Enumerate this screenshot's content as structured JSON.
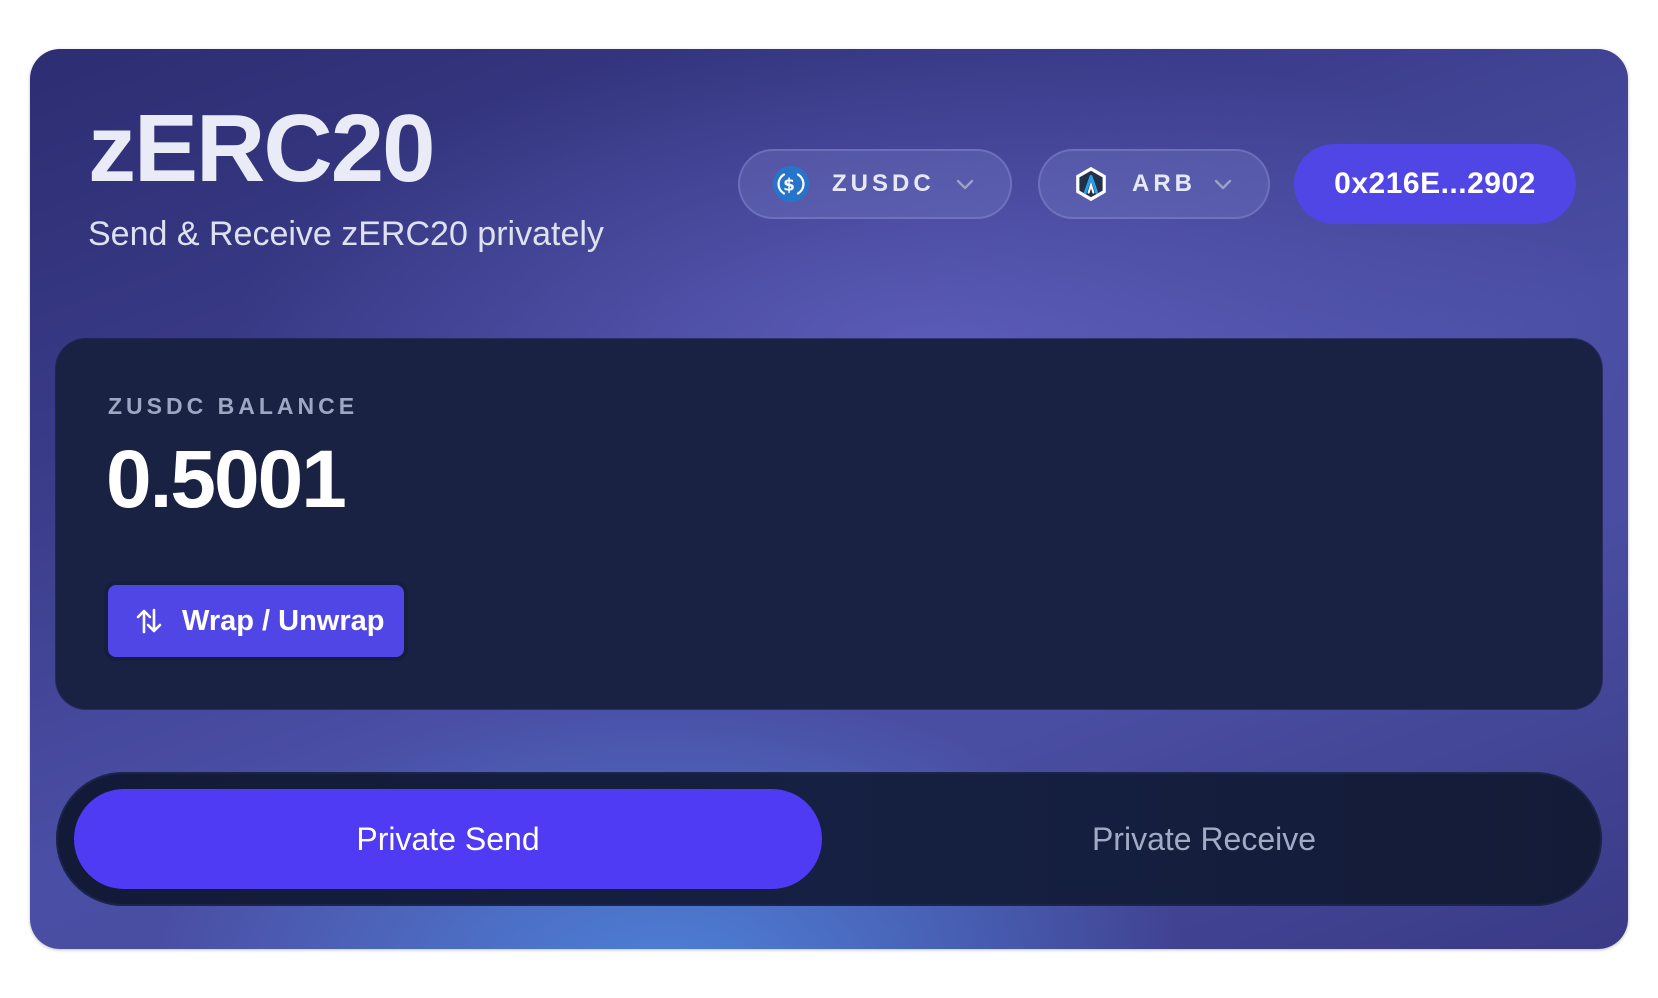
{
  "header": {
    "title": "zERC20",
    "subtitle": "Send & Receive zERC20 privately"
  },
  "token_selector": {
    "label": "ZUSDC",
    "icon": "usdc-coin-icon",
    "chevron": "chevron-down-icon"
  },
  "chain_selector": {
    "label": "ARB",
    "icon": "arbitrum-icon",
    "chevron": "chevron-down-icon"
  },
  "wallet": {
    "address": "0x216E...2902"
  },
  "balance": {
    "label": "ZUSDC BALANCE",
    "value": "0.5001"
  },
  "wrap_button": {
    "label": "Wrap / Unwrap",
    "icon": "swap-vertical-icon"
  },
  "tabs": [
    {
      "label": "Private Send",
      "active": true
    },
    {
      "label": "Private Receive",
      "active": false
    }
  ],
  "colors": {
    "accent": "#4f46e5",
    "active_tab": "#4f3bf3",
    "panel": "#1a2244",
    "usdc_blue": "#2775ca",
    "arbitrum_blue": "#28a0f0"
  }
}
